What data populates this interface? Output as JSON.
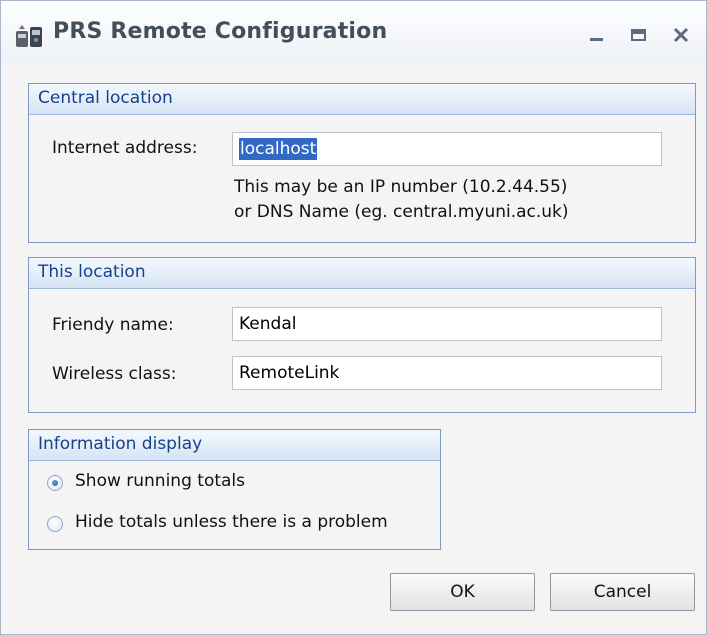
{
  "window": {
    "title": "PRS Remote Configuration",
    "icon": "remote-handset-icon",
    "controls": {
      "minimize": "minimize-icon",
      "maximize": "maximize-icon",
      "close": "close-icon"
    }
  },
  "central_location": {
    "title": "Central location",
    "internet_address_label": "Internet address:",
    "internet_address_value": "localhost",
    "hint_line1": "This may be an IP number (10.2.44.55)",
    "hint_line2": "or DNS Name (eg. central.myuni.ac.uk)"
  },
  "this_location": {
    "title": "This location",
    "friendly_name_label": "Friendy name:",
    "friendly_name_value": "Kendal",
    "wireless_class_label": "Wireless class:",
    "wireless_class_value": "RemoteLink"
  },
  "information_display": {
    "title": "Information display",
    "options": [
      {
        "label": "Show running totals",
        "checked": true
      },
      {
        "label": "Hide totals unless there is a problem",
        "checked": false
      }
    ]
  },
  "buttons": {
    "ok": "OK",
    "cancel": "Cancel"
  },
  "colors": {
    "group_title": "#15428b",
    "group_border": "#7b9ac6",
    "selection": "#3169c6",
    "window_background": "#f4f4f4"
  }
}
